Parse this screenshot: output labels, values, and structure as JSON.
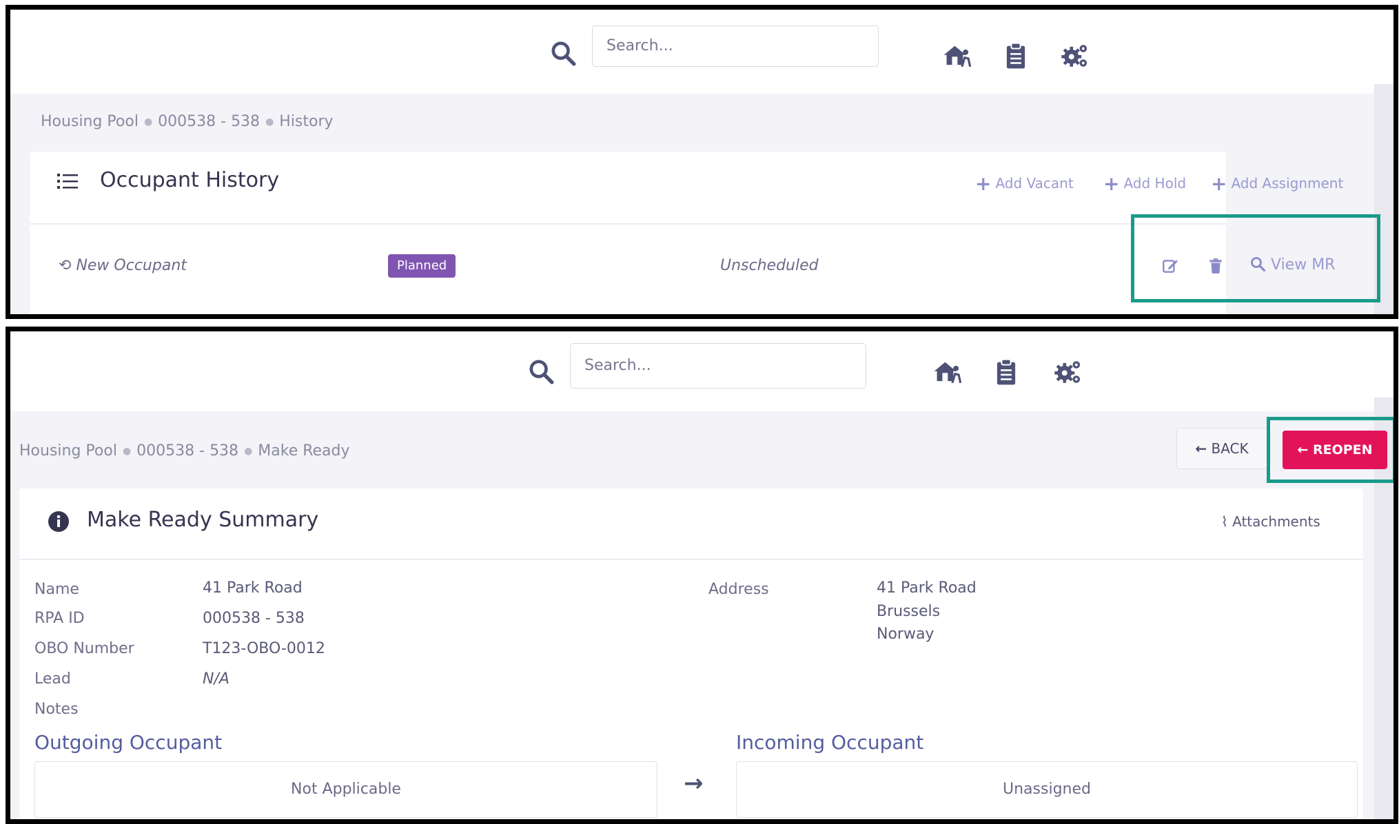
{
  "top_panel": {
    "search_placeholder": "Search...",
    "breadcrumb": [
      "Housing Pool",
      "000538 - 538",
      "History"
    ],
    "card_title": "Occupant History",
    "actions": [
      "Add Vacant",
      "Add Hold",
      "Add Assignment"
    ],
    "row": {
      "occupant": "New Occupant",
      "status": "Planned",
      "schedule": "Unscheduled",
      "view_link": "View MR"
    }
  },
  "bottom_panel": {
    "search_placeholder": "Search...",
    "breadcrumb": [
      "Housing Pool",
      "000538 - 538",
      "Make Ready"
    ],
    "back_label": "BACK",
    "reopen_label": "REOPEN",
    "card_title": "Make Ready Summary",
    "attachments_label": "Attachments",
    "fields": [
      {
        "label": "Name",
        "value": "41 Park Road"
      },
      {
        "label": "RPA ID",
        "value": "000538 - 538"
      },
      {
        "label": "OBO Number",
        "value": "T123-OBO-0012"
      },
      {
        "label": "Lead",
        "value": "N/A"
      },
      {
        "label": "Notes",
        "value": ""
      }
    ],
    "address_label": "Address",
    "address_lines": [
      "41 Park Road",
      "Brussels",
      "Norway"
    ],
    "outgoing_title": "Outgoing Occupant",
    "outgoing_value": "Not Applicable",
    "incoming_title": "Incoming Occupant",
    "incoming_value": "Unassigned"
  },
  "colors": {
    "accent_purple": "#7f55b1",
    "reopen_red": "#e3135a",
    "highlight_teal": "#1a9a8a",
    "link_lavender": "#9a9ad0"
  }
}
